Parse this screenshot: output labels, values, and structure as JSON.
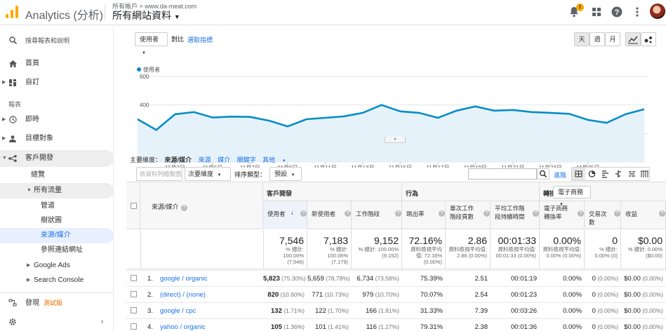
{
  "app": {
    "title": "Analytics (分析)",
    "account_crumb": "所有帳戶 > www.da-meat.com",
    "view_name": "所有網站資料",
    "notification_count": "2"
  },
  "sidebar": {
    "search": "搜尋報表和說明",
    "home": "首頁",
    "custom": "自訂",
    "reports_label": "報表",
    "realtime": "即時",
    "audience": "目標對象",
    "acquisition": "客戶開發",
    "overview": "總覽",
    "all_traffic": "所有流量",
    "channels": "管道",
    "treemaps": "樹狀圖",
    "source_medium": "來源/媒介",
    "referrals": "參照連結網址",
    "google_ads": "Google Ads",
    "search_console": "Search Console",
    "discover": "發現",
    "beta": "測試版"
  },
  "controls": {
    "metric_select": "使用者",
    "vs": "對比",
    "select_metric": "選取指標",
    "day": "天",
    "week": "週",
    "month": "月"
  },
  "chart_data": {
    "type": "area",
    "series": [
      {
        "name": "使用者",
        "color": "#058dc7",
        "values": [
          300,
          225,
          335,
          350,
          312,
          318,
          316,
          290,
          250,
          300,
          310,
          320,
          345,
          400,
          355,
          345,
          310,
          360,
          390,
          360,
          365,
          350,
          345,
          338,
          295,
          275,
          335,
          370
        ]
      }
    ],
    "x": [
      "11月1日",
      "11月2日",
      "11月3日",
      "11月4日",
      "11月5日",
      "11月6日",
      "11月7日",
      "11月8日",
      "11月9日",
      "11月10日",
      "11月11日",
      "11月12日",
      "11月13日",
      "11月14日",
      "11月15日",
      "11月16日",
      "11月17日",
      "11月18日",
      "11月19日",
      "11月20日",
      "11月21日",
      "11月22日",
      "11月23日",
      "11月24日",
      "11月25日",
      "11月26日",
      "11月27日",
      "11月28日"
    ],
    "x_tick_labels": [
      "11月3日",
      "11月5日",
      "11月7日",
      "11月9日",
      "11月11日",
      "11月13日",
      "11月15日",
      "11月17日",
      "11月19日",
      "11月21日",
      "11月23日",
      "11月25日"
    ],
    "y_ticks": [
      "600",
      "400",
      "200"
    ],
    "ylim": [
      0,
      600
    ],
    "legend": "top-left"
  },
  "dimension_bar": {
    "label": "主要維度：",
    "current": "來源/媒介",
    "options": [
      "來源",
      "媒介",
      "關鍵字",
      "其他"
    ]
  },
  "tools": {
    "plot_rows": "依資料列繪製圖表",
    "secondary_dim": "次要維度",
    "sort_type_label": "排序類型：",
    "sort_default": "預設",
    "advanced": "進階"
  },
  "table": {
    "dim_header": "來源/媒介",
    "group_acq": "客戶開發",
    "group_behavior": "行為",
    "group_conv": "轉換",
    "conv_select": "電子商務",
    "headers": [
      "使用者",
      "新使用者",
      "工作階段",
      "跳出率",
      "單次工作階段頁數",
      "平均工作階段持續時間",
      "電子商務轉換率",
      "交易次數",
      "收益"
    ],
    "totals": [
      {
        "v": "7,546",
        "s": "% 總計: 100.00% (7,546)"
      },
      {
        "v": "7,183",
        "s": "% 總計: 100.06% (7,179)"
      },
      {
        "v": "9,152",
        "s": "% 總計: 100.00% (9,152)"
      },
      {
        "v": "72.16%",
        "s": "資料檢視平均值: 72.16% (0.00%)"
      },
      {
        "v": "2.86",
        "s": "資料檢視平均值: 2.86 (0.00%)"
      },
      {
        "v": "00:01:33",
        "s": "資料檢視平均值: 00:01:33 (0.00%)"
      },
      {
        "v": "0.00%",
        "s": "資料檢視平均值: 0.00% (0.00%)"
      },
      {
        "v": "0",
        "s": "% 總計: 0.00% (0)"
      },
      {
        "v": "$0.00",
        "s": "% 總計: 0.00% ($0.00)"
      }
    ],
    "rows": [
      {
        "n": "1.",
        "name": "google / organic",
        "users": "5,823",
        "users_p": "(75.30%)",
        "new": "5,659",
        "new_p": "(78.78%)",
        "sess": "6,734",
        "sess_p": "(73.58%)",
        "bounce": "75.39%",
        "pages": "2.51",
        "dur": "00:01:19",
        "conv": "0.00%",
        "tx": "0",
        "tx_p": "(0.00%)",
        "rev": "$0.00",
        "rev_p": "(0.00%)"
      },
      {
        "n": "2.",
        "name": "(direct) / (none)",
        "users": "820",
        "users_p": "(10.60%)",
        "new": "771",
        "new_p": "(10.73%)",
        "sess": "979",
        "sess_p": "(10.70%)",
        "bounce": "70.07%",
        "pages": "2.54",
        "dur": "00:01:23",
        "conv": "0.00%",
        "tx": "0",
        "tx_p": "(0.00%)",
        "rev": "$0.00",
        "rev_p": "(0.00%)"
      },
      {
        "n": "3.",
        "name": "google / cpc",
        "users": "132",
        "users_p": "(1.71%)",
        "new": "122",
        "new_p": "(1.70%)",
        "sess": "166",
        "sess_p": "(1.81%)",
        "bounce": "31.33%",
        "pages": "7.39",
        "dur": "00:03:26",
        "conv": "0.00%",
        "tx": "0",
        "tx_p": "(0.00%)",
        "rev": "$0.00",
        "rev_p": "(0.00%)"
      },
      {
        "n": "4.",
        "name": "yahoo / organic",
        "users": "105",
        "users_p": "(1.36%)",
        "new": "101",
        "new_p": "(1.41%)",
        "sess": "116",
        "sess_p": "(1.27%)",
        "bounce": "79.31%",
        "pages": "2.38",
        "dur": "00:01:36",
        "conv": "0.00%",
        "tx": "0",
        "tx_p": "(0.00%)",
        "rev": "$0.00",
        "rev_p": "(0.00%)"
      }
    ]
  }
}
